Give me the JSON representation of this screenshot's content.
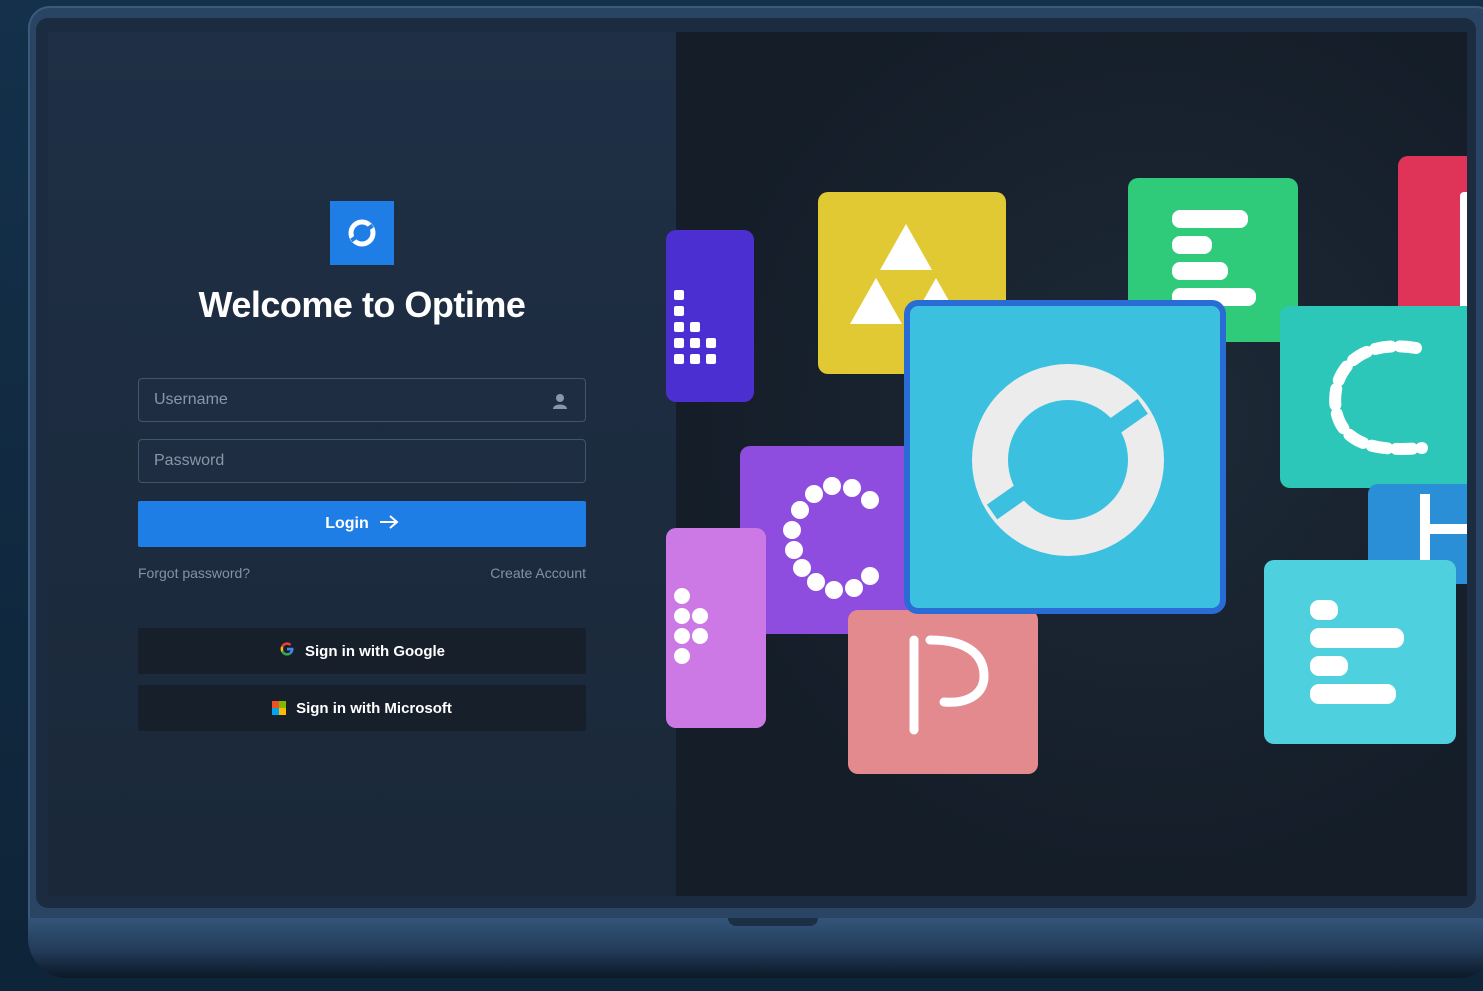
{
  "app": {
    "name": "Optime",
    "welcome": "Welcome to Optime"
  },
  "form": {
    "username_placeholder": "Username",
    "password_placeholder": "Password",
    "login_label": "Login",
    "forgot_label": "Forgot password?",
    "create_label": "Create Account"
  },
  "sso": {
    "google_label": "Sign in with Google",
    "microsoft_label": "Sign in with Microsoft"
  },
  "colors": {
    "accent": "#1f7de6",
    "panel": "#1f2f45",
    "sso_button": "#171f2b"
  },
  "icons": {
    "logo": "optime-ring-logo",
    "username": "user-icon",
    "login": "arrow-right-icon",
    "google": "google-logo-icon",
    "microsoft": "microsoft-logo-icon"
  }
}
